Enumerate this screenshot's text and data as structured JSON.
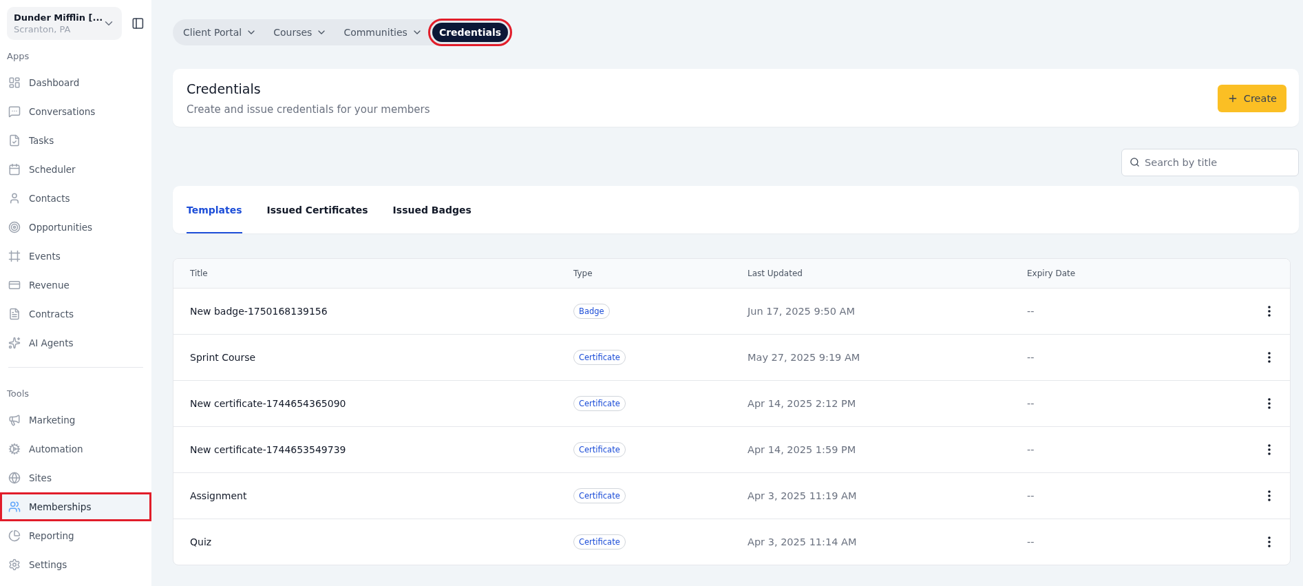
{
  "account": {
    "name": "Dunder Mifflin [...",
    "location": "Scranton, PA"
  },
  "sidebar": {
    "sections": [
      {
        "title": "Apps",
        "items": [
          {
            "label": "Dashboard",
            "selected": false,
            "highlighted": false
          },
          {
            "label": "Conversations",
            "selected": false,
            "highlighted": false
          },
          {
            "label": "Tasks",
            "selected": false,
            "highlighted": false
          },
          {
            "label": "Scheduler",
            "selected": false,
            "highlighted": false
          },
          {
            "label": "Contacts",
            "selected": false,
            "highlighted": false
          },
          {
            "label": "Opportunities",
            "selected": false,
            "highlighted": false
          },
          {
            "label": "Events",
            "selected": false,
            "highlighted": false
          },
          {
            "label": "Revenue",
            "selected": false,
            "highlighted": false
          },
          {
            "label": "Contracts",
            "selected": false,
            "highlighted": false
          },
          {
            "label": "AI Agents",
            "selected": false,
            "highlighted": false
          }
        ]
      },
      {
        "title": "Tools",
        "items": [
          {
            "label": "Marketing",
            "selected": false,
            "highlighted": false
          },
          {
            "label": "Automation",
            "selected": false,
            "highlighted": false
          },
          {
            "label": "Sites",
            "selected": false,
            "highlighted": false
          },
          {
            "label": "Memberships",
            "selected": true,
            "highlighted": true
          },
          {
            "label": "Reporting",
            "selected": false,
            "highlighted": false
          },
          {
            "label": "Settings",
            "selected": false,
            "highlighted": false
          }
        ]
      }
    ]
  },
  "top_nav": [
    {
      "label": "Client Portal",
      "dropdown": true,
      "selected": false,
      "highlighted": false
    },
    {
      "label": "Courses",
      "dropdown": true,
      "selected": false,
      "highlighted": false
    },
    {
      "label": "Communities",
      "dropdown": true,
      "selected": false,
      "highlighted": false
    },
    {
      "label": "Credentials",
      "dropdown": false,
      "selected": true,
      "highlighted": true
    }
  ],
  "header": {
    "title": "Credentials",
    "subtitle": "Create and issue credentials for your members",
    "button": "Create"
  },
  "search": {
    "placeholder": "Search by title"
  },
  "tabs": [
    {
      "label": "Templates",
      "selected": true
    },
    {
      "label": "Issued Certificates",
      "selected": false
    },
    {
      "label": "Issued Badges",
      "selected": false
    }
  ],
  "table": {
    "columns": [
      "Title",
      "Type",
      "Last Updated",
      "Expiry Date"
    ],
    "rows": [
      {
        "title": "New badge-1750168139156",
        "type": "Badge",
        "updated": "Jun 17, 2025 9:50 AM",
        "expiry": "--"
      },
      {
        "title": "Sprint Course",
        "type": "Certificate",
        "updated": "May 27, 2025 9:19 AM",
        "expiry": "--"
      },
      {
        "title": "New certificate-1744654365090",
        "type": "Certificate",
        "updated": "Apr 14, 2025 2:12 PM",
        "expiry": "--"
      },
      {
        "title": "New certificate-1744653549739",
        "type": "Certificate",
        "updated": "Apr 14, 2025 1:59 PM",
        "expiry": "--"
      },
      {
        "title": "Assignment",
        "type": "Certificate",
        "updated": "Apr 3, 2025 11:19 AM",
        "expiry": "--"
      },
      {
        "title": "Quiz",
        "type": "Certificate",
        "updated": "Apr 3, 2025 11:14 AM",
        "expiry": "--"
      }
    ]
  }
}
